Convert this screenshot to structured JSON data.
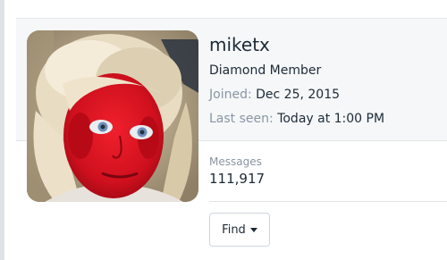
{
  "profile": {
    "username": "miketx",
    "user_title": "Diamond Member",
    "joined_label": "Joined:",
    "joined_value": "Dec 25, 2015",
    "last_seen_label": "Last seen:",
    "last_seen_value": "Today at 1:00 PM",
    "avatar_icon": "user-avatar-photo"
  },
  "stats": {
    "messages_label": "Messages",
    "messages_value": "111,917"
  },
  "actions": {
    "find_label": "Find",
    "find_icon": "caret-down-icon"
  },
  "colors": {
    "header_bg": "#f5f7f9",
    "text": "#1d2a36",
    "muted": "#8a96a3",
    "border": "#cfd5db"
  }
}
